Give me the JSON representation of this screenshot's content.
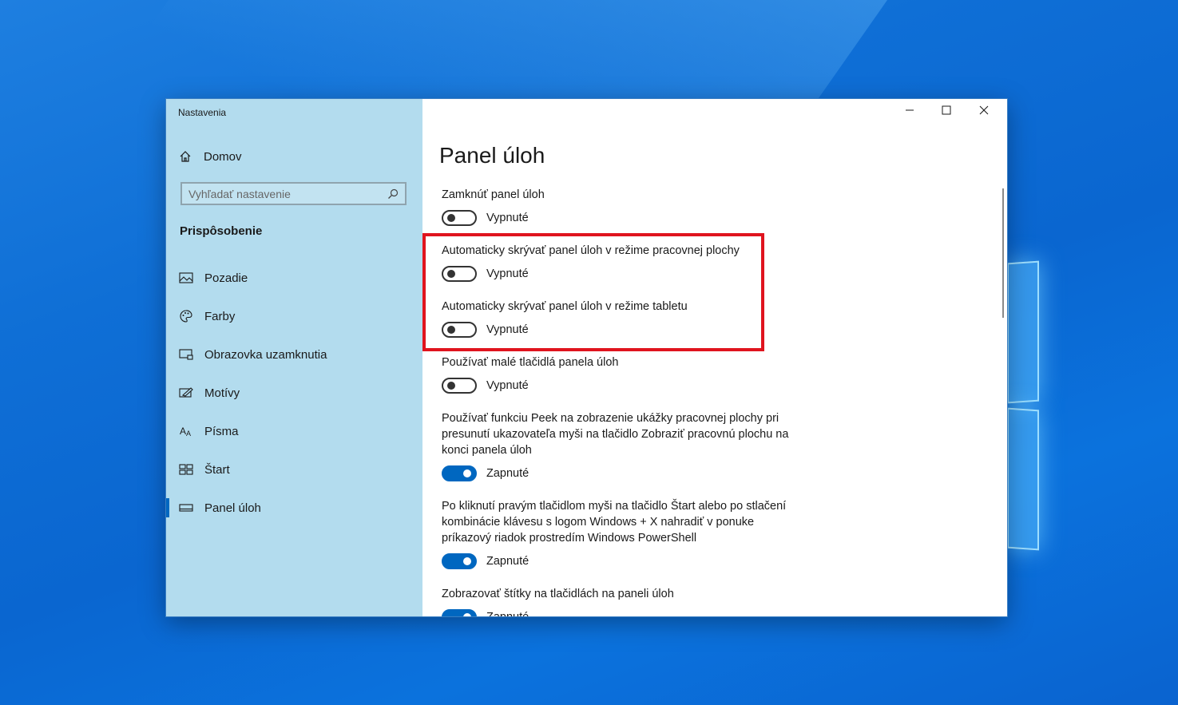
{
  "window": {
    "app_title": "Nastavenia",
    "controls": {
      "minimize": "minimize-icon",
      "maximize": "maximize-icon",
      "close": "close-icon"
    }
  },
  "sidebar": {
    "home_label": "Domov",
    "search_placeholder": "Vyhľadať nastavenie",
    "section_title": "Prispôsobenie",
    "items": [
      {
        "label": "Pozadie",
        "icon": "picture-icon"
      },
      {
        "label": "Farby",
        "icon": "palette-icon"
      },
      {
        "label": "Obrazovka uzamknutia",
        "icon": "lock-screen-icon"
      },
      {
        "label": "Motívy",
        "icon": "themes-icon"
      },
      {
        "label": "Písma",
        "icon": "fonts-icon"
      },
      {
        "label": "Štart",
        "icon": "start-icon"
      },
      {
        "label": "Panel úloh",
        "icon": "taskbar-icon",
        "selected": true
      }
    ]
  },
  "main": {
    "title": "Panel úloh",
    "settings": [
      {
        "label": "Zamknúť panel úloh",
        "state": "Vypnuté",
        "on": false
      },
      {
        "label": "Automaticky skrývať panel úloh v režime pracovnej plochy",
        "state": "Vypnuté",
        "on": false,
        "highlighted": true
      },
      {
        "label": "Automaticky skrývať panel úloh v režime tabletu",
        "state": "Vypnuté",
        "on": false,
        "highlighted": true
      },
      {
        "label": "Používať malé tlačidlá panela úloh",
        "state": "Vypnuté",
        "on": false
      },
      {
        "label": "Používať funkciu Peek na zobrazenie ukážky pracovnej plochy pri presunutí ukazovateľa myši na tlačidlo Zobraziť pracovnú plochu na konci panela úloh",
        "state": "Zapnuté",
        "on": true
      },
      {
        "label": "Po kliknutí pravým tlačidlom myši na tlačidlo Štart alebo po stlačení kombinácie klávesu s logom Windows + X nahradiť v ponuke príkazový riadok prostredím Windows PowerShell",
        "state": "Zapnuté",
        "on": true
      },
      {
        "label": "Zobrazovať štítky na tlačidlách na paneli úloh",
        "state": "Zapnuté",
        "on": true
      }
    ]
  },
  "colors": {
    "accent": "#0067c0",
    "highlight": "#e0141e",
    "sidebar_bg": "#b3dcee"
  }
}
